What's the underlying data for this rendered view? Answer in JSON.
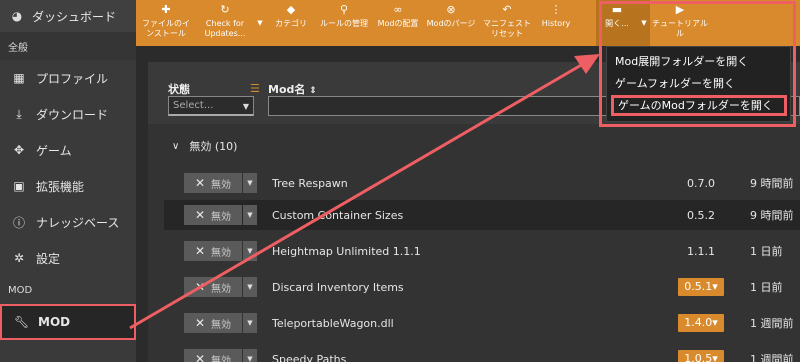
{
  "sidebar": {
    "dashboard": "ダッシュボード",
    "section_general": "全般",
    "items": [
      {
        "label": "プロファイル",
        "icon": "profile-icon"
      },
      {
        "label": "ダウンロード",
        "icon": "download-icon"
      },
      {
        "label": "ゲーム",
        "icon": "gamepad-icon"
      },
      {
        "label": "拡張機能",
        "icon": "extensions-icon"
      },
      {
        "label": "ナレッジベース",
        "icon": "info-icon"
      },
      {
        "label": "設定",
        "icon": "gear-icon"
      }
    ],
    "section_mod": "MOD",
    "mod_item": "MOD"
  },
  "toolbar": {
    "install_file": "ファイルのイ\nンストール",
    "check_updates": "Check for\nUpdates...",
    "category": "カテゴリ",
    "rules": "ルールの管理",
    "mod_deploy": "Modの配置",
    "mod_purge": "Modのパージ",
    "manifest_reset": "マニフェスト\nリセット",
    "history": "History",
    "open": "開く...",
    "tutorial": "チュートリアル\nル"
  },
  "filters": {
    "status_label": "状態",
    "status_placeholder": "Select...",
    "mod_name_label": "Mod名"
  },
  "group": {
    "label": "無効 (10)"
  },
  "mods": [
    {
      "toggle": "無効",
      "name": "Tree Respawn",
      "version": "0.7.0",
      "version_badge": false,
      "time": "9 時間前"
    },
    {
      "toggle": "無効",
      "name": "Custom Container Sizes",
      "version": "0.5.2",
      "version_badge": false,
      "time": "9 時間前"
    },
    {
      "toggle": "無効",
      "name": "Heightmap Unlimited 1.1.1",
      "version": "1.1.1",
      "version_badge": false,
      "time": "1 日前"
    },
    {
      "toggle": "無効",
      "name": "Discard Inventory Items",
      "version": "0.5.1▾",
      "version_badge": true,
      "time": "1 日前"
    },
    {
      "toggle": "無効",
      "name": "TeleportableWagon.dll",
      "version": "1.4.0▾",
      "version_badge": true,
      "time": "1 週間前"
    },
    {
      "toggle": "無効",
      "name": "Speedy Paths",
      "version": "1.0.5▾",
      "version_badge": true,
      "time": "1 週間前"
    }
  ],
  "menu": {
    "items": [
      "Mod展開フォルダーを開く",
      "ゲームフォルダーを開く",
      "ゲームのModフォルダーを開く"
    ]
  },
  "colors": {
    "accent": "#d88a2c",
    "highlight": "#ee5f63"
  }
}
